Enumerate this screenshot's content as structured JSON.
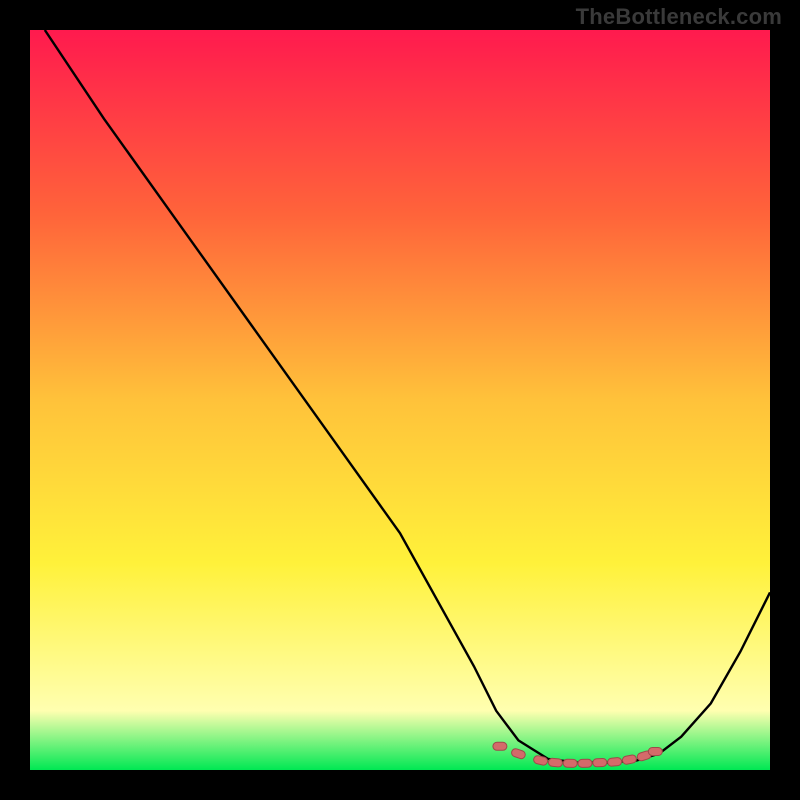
{
  "watermark": "TheBottleneck.com",
  "colors": {
    "bg": "#000000",
    "grad_top": "#ff1a4e",
    "grad_mid1": "#ff643a",
    "grad_mid2": "#ffc23a",
    "grad_mid3": "#fff13a",
    "grad_mid4": "#ffffb0",
    "grad_bottom": "#00e853",
    "curve": "#000000",
    "marker_fill": "#d46a6a",
    "marker_stroke": "#9e4a4a"
  },
  "chart_data": {
    "type": "line",
    "title": "",
    "xlabel": "",
    "ylabel": "",
    "xlim": [
      0,
      100
    ],
    "ylim": [
      0,
      100
    ],
    "series": [
      {
        "name": "curve",
        "x": [
          2,
          10,
          20,
          30,
          40,
          50,
          60,
          63,
          66,
          70,
          74,
          78,
          82,
          85,
          88,
          92,
          96,
          100
        ],
        "y": [
          100,
          88,
          74,
          60,
          46,
          32,
          14,
          8,
          4,
          1.5,
          1,
          1,
          1.3,
          2.2,
          4.5,
          9,
          16,
          24
        ]
      }
    ],
    "markers": {
      "name": "highlight-band",
      "x": [
        63.5,
        66,
        69,
        71,
        73,
        75,
        77,
        79,
        81,
        83,
        84.5
      ],
      "y": [
        3.2,
        2.2,
        1.3,
        1.0,
        0.9,
        0.9,
        1.0,
        1.1,
        1.4,
        1.9,
        2.5
      ]
    }
  }
}
